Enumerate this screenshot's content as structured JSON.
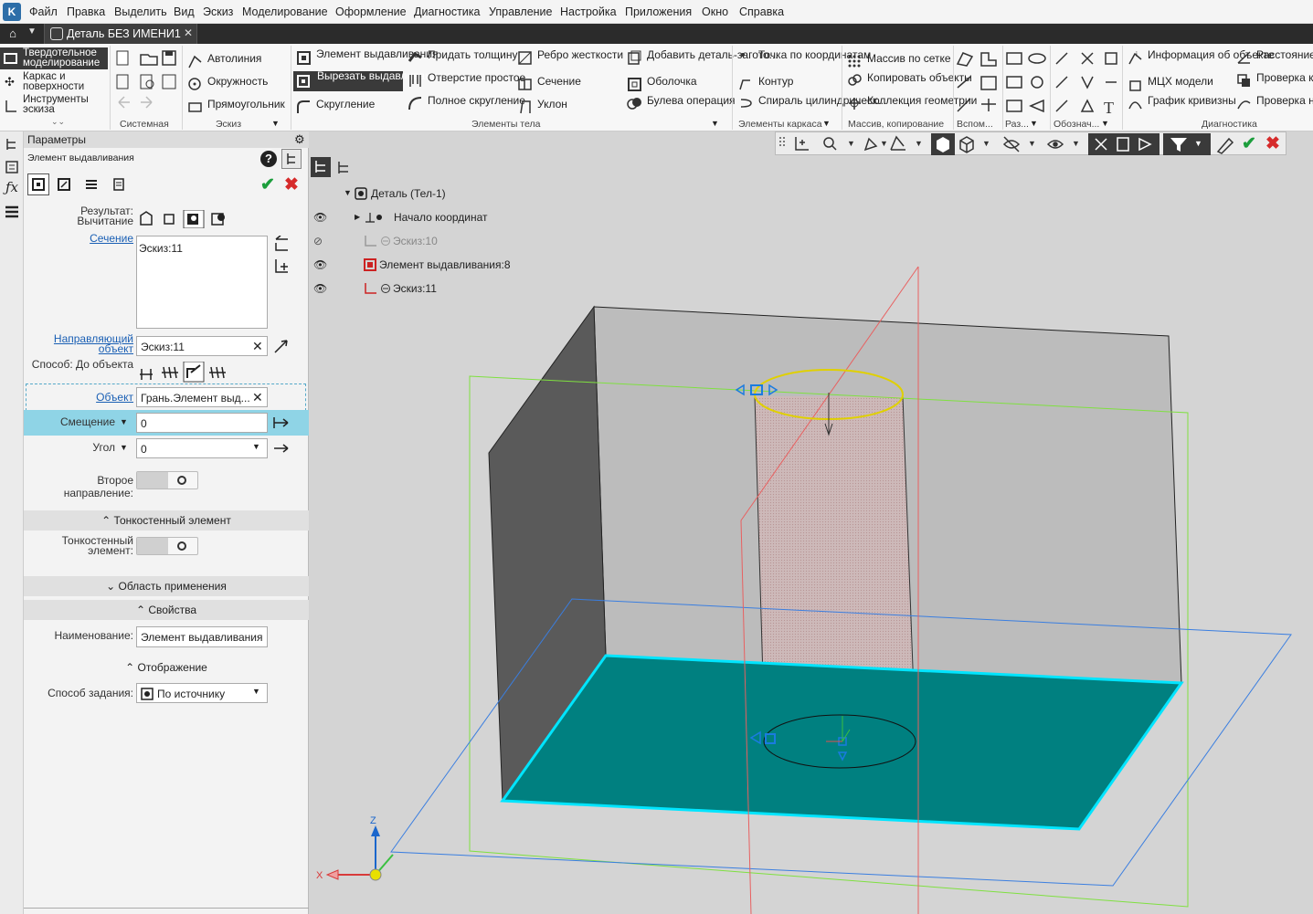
{
  "menu": [
    "Файл",
    "Правка",
    "Выделить",
    "Вид",
    "Эскиз",
    "Моделирование",
    "Оформление",
    "Диагностика",
    "Управление",
    "Настройка",
    "Приложения",
    "Окно",
    "Справка"
  ],
  "tab": {
    "title": "Деталь БЕЗ ИМЕНИ1"
  },
  "ribbon": {
    "modes": [
      "Твердотельное моделирование",
      "Каркас и поверхности",
      "Инструменты эскиза"
    ],
    "groups": {
      "system": "Системная",
      "sketch": "Эскиз",
      "body": "Элементы тела",
      "frame": "Элементы каркаса",
      "array": "Массив, копирование",
      "aux": "Вспом...",
      "razm": "Раз...",
      "oboz": "Обознач...",
      "diag": "Диагностика"
    },
    "sketch_tools": [
      "Автолиния",
      "Окружность",
      "Прямоугольник"
    ],
    "body_col1": [
      "Элемент выдавливания",
      "Вырезать выдавливанием",
      "Скругление"
    ],
    "body_col2": [
      "Придать толщину",
      "Отверстие простое",
      "Полное скругление"
    ],
    "body_col3": [
      "Ребро жесткости",
      "Сечение",
      "Уклон"
    ],
    "body_col4": [
      "Добавить деталь-загото...",
      "Оболочка",
      "Булева операция"
    ],
    "frame_col": [
      "Точка по координатам",
      "Контур",
      "Спираль цилиндрическ..."
    ],
    "array_col": [
      "Массив по сетке",
      "Копировать объекты",
      "Коллекция геометрии"
    ],
    "diag_col1": [
      "Информация об объекте",
      "МЦХ модели",
      "График кривизны"
    ],
    "diag_col2": [
      "Расстояние и угол",
      "Проверка коллизий",
      "Проверка непрерывн..."
    ]
  },
  "panel": {
    "title": "Параметры",
    "subtitle": "Элемент выдавливания",
    "result_label": "Результат: Вычитание",
    "section_link": "Сечение",
    "section_value": "Эскиз:11",
    "guide_link": "Направляющий объект",
    "guide_value": "Эскиз:11",
    "method_label": "Способ: До объекта",
    "object_link": "Объект",
    "object_value": "Грань.Элемент выд...",
    "offset_label": "Смещение",
    "offset_value": "0",
    "angle_label": "Угол",
    "angle_value": "0",
    "second_dir_label": "Второе направление:",
    "thin_section": "Тонкостенный элемент",
    "thin_label": "Тонкостенный элемент:",
    "scope_section": "Область применения",
    "props_section": "Свойства",
    "name_label": "Наименование:",
    "name_value": "Элемент выдавливания",
    "display_section": "Отображение",
    "mode_label": "Способ задания:",
    "mode_value": "По источнику"
  },
  "tree": {
    "root": "Деталь (Тел-1)",
    "items": [
      "Начало координат",
      "Эскиз:10",
      "Элемент выдавливания:8",
      "Эскиз:11"
    ]
  },
  "axes": {
    "x": "X",
    "z": "Z"
  },
  "colors": {
    "accent": "#2d6ea8",
    "highlight_row": "#8fd4e6",
    "face": "#008080",
    "edge_cyan": "#00e5ff",
    "ok": "#1c9e3c",
    "cancel": "#d62a2a"
  }
}
